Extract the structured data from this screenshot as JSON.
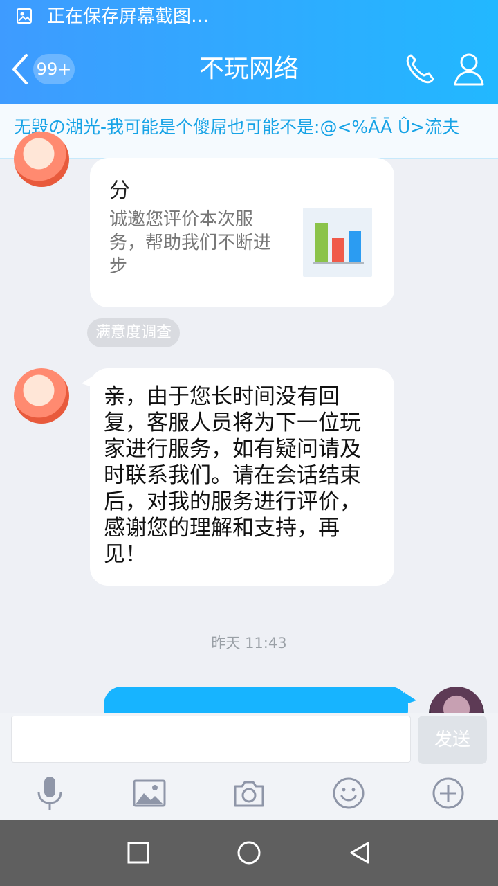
{
  "status_bar": {
    "text": "正在保存屏幕截图…"
  },
  "nav": {
    "title": "不玩网络",
    "badge": "99+"
  },
  "notice": {
    "text": "无毁の湖光-我可能是个傻屌也可能不是:@<%ĀĀ Û>流夫"
  },
  "card": {
    "title": "请您为客服的服务质量打分",
    "title_visible": "分",
    "desc": "诚邀您评价本次服务，帮助我们不断进步",
    "desc_lines": [
      "诚邀您评价本次服",
      "务，帮助我们不断进",
      "步"
    ],
    "tag": "满意度调查"
  },
  "message": {
    "text": "亲，由于您长时间没有回复，客服人员将为下一位玩家进行服务，如有疑问请及时联系我们。请在会话结束后，对我的服务进行评价，感谢您的理解和支持，再见！",
    "lines": [
      "亲，由于您长时间没有回",
      "复，客服人员将为下一位玩",
      "家进行服务，如有疑问请及",
      "时联系我们。请在会话结束",
      "后，对我的服务进行评价，",
      "感谢您的理解和支持，再",
      "见！"
    ]
  },
  "timestamp": "昨天 11:43",
  "composer": {
    "placeholder": "",
    "send_label": "发送"
  },
  "colors": {
    "header_start": "#3e9bff",
    "header_end": "#22b8ff",
    "outgoing": "#17b4ff",
    "notice_text": "#17a3e6"
  },
  "icons": [
    "image-icon",
    "back-icon",
    "phone-icon",
    "user-icon",
    "mic-icon",
    "picture-icon",
    "camera-icon",
    "emoji-icon",
    "plus-icon",
    "recent-apps-icon",
    "home-icon",
    "back-nav-icon"
  ]
}
